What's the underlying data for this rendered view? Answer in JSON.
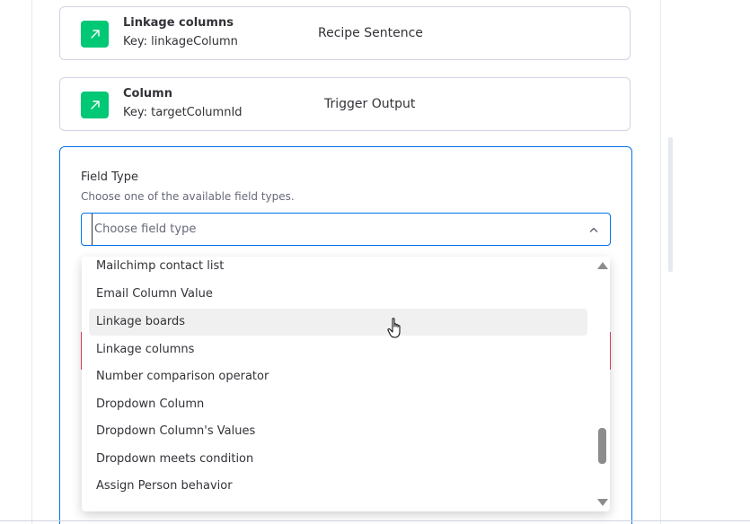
{
  "fields": [
    {
      "title": "Linkage columns",
      "key": "Key: linkageColumn",
      "source": "Recipe Sentence"
    },
    {
      "title": "Column",
      "key": "Key: targetColumnId",
      "source": "Trigger Output"
    }
  ],
  "editor": {
    "label": "Field Type",
    "description": "Choose one of the available field types.",
    "select": {
      "placeholder": "Choose field type",
      "value": ""
    }
  },
  "dropdown": {
    "hovered_index": 2,
    "items": [
      "Mailchimp contact list",
      "Email Column Value",
      "Linkage boards",
      "Linkage columns",
      "Number comparison operator",
      "Dropdown Column",
      "Dropdown Column's Values",
      "Dropdown meets condition",
      "Assign Person behavior"
    ],
    "scroll_position": 0.7
  },
  "colors": {
    "accent": "#0073ea",
    "icon_green": "#00c875",
    "error_red": "#e2445c",
    "hover_bg": "#f0f0f0"
  },
  "icons": {
    "field_icon": "arrow-up-right-icon",
    "select_icon": "chevron-up-icon",
    "cursor": "hand-pointer-cursor"
  }
}
